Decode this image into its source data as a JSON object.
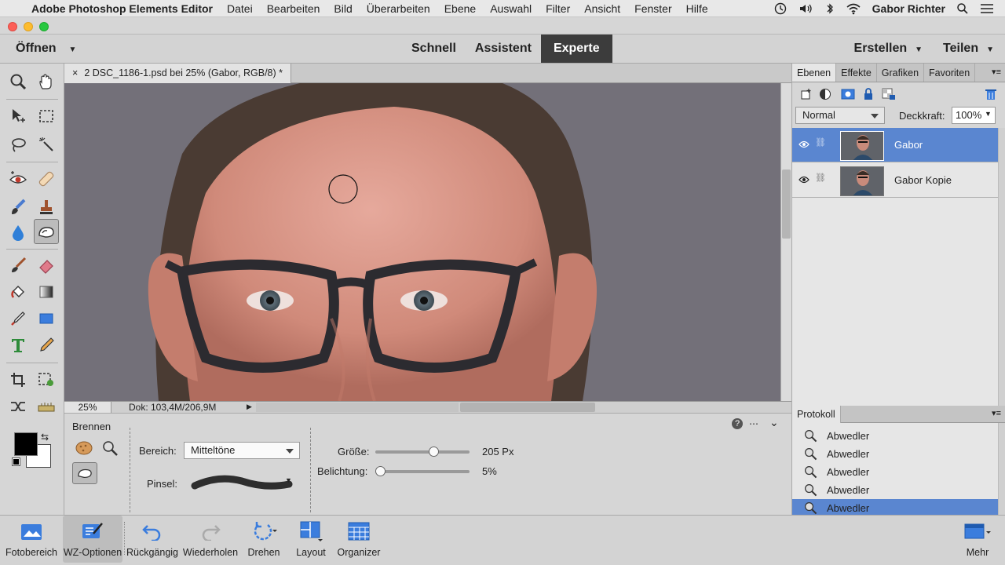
{
  "menubar": {
    "app_name": "Adobe Photoshop Elements Editor",
    "items": [
      "Datei",
      "Bearbeiten",
      "Bild",
      "Überarbeiten",
      "Ebene",
      "Auswahl",
      "Filter",
      "Ansicht",
      "Fenster",
      "Hilfe"
    ],
    "user": "Gabor Richter"
  },
  "modebar": {
    "open_label": "Öffnen",
    "modes": [
      "Schnell",
      "Assistent",
      "Experte"
    ],
    "active_mode": "Experte",
    "create_label": "Erstellen",
    "share_label": "Teilen"
  },
  "document": {
    "tab_title": "2 DSC_1186-1.psd bei 25% (Gabor, RGB/8) *",
    "zoom": "25%",
    "doc_info": "Dok: 103,4M/206,9M"
  },
  "tool_options": {
    "tool_name": "Brennen",
    "range_label": "Bereich:",
    "range_value": "Mitteltöne",
    "brush_label": "Pinsel:",
    "size_label": "Größe:",
    "size_value": "205 Px",
    "size_fraction": 0.62,
    "exposure_label": "Belichtung:",
    "exposure_value": "5%",
    "exposure_fraction": 0.05
  },
  "layers_panel": {
    "tabs": [
      "Ebenen",
      "Effekte",
      "Grafiken",
      "Favoriten"
    ],
    "active_tab": "Ebenen",
    "blend_mode": "Normal",
    "opacity_label": "Deckkraft:",
    "opacity_value": "100%",
    "layers": [
      {
        "name": "Gabor",
        "selected": true
      },
      {
        "name": "Gabor Kopie",
        "selected": false
      }
    ]
  },
  "history_panel": {
    "title": "Protokoll",
    "items": [
      "Abwedler",
      "Abwedler",
      "Abwedler",
      "Abwedler",
      "Abwedler"
    ]
  },
  "bottombar": {
    "items": [
      "Fotobereich",
      "WZ-Optionen",
      "Rückgängig",
      "Wiederholen",
      "Drehen",
      "Layout",
      "Organizer"
    ],
    "more_label": "Mehr"
  },
  "colors": {
    "accent": "#5a86d0",
    "active_mode_bg": "#3c3c3c",
    "foreground": "#000000",
    "background": "#ffffff"
  }
}
